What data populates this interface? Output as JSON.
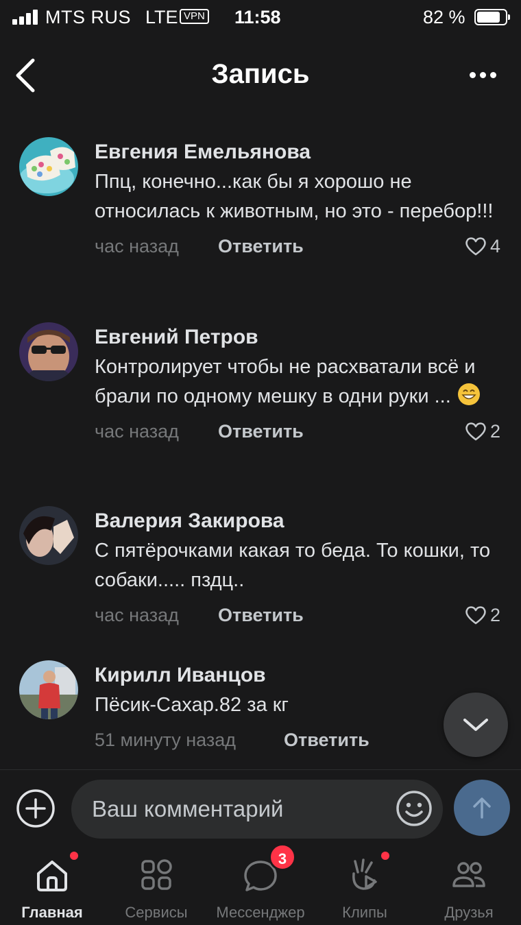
{
  "status_bar": {
    "carrier": "MTS RUS",
    "network": "LTE",
    "vpn": "VPN",
    "time": "11:58",
    "battery": "82 %"
  },
  "header": {
    "title": "Запись",
    "back_icon": "chevron-left-icon",
    "more_icon": "ellipsis-icon"
  },
  "comments": [
    {
      "author": "Евгения Емельянова",
      "text": "Ппц, конечно...как бы я хорошо не относилась к животным, но это - перебор!!!",
      "time": "час назад",
      "reply": "Ответить",
      "likes": "4"
    },
    {
      "author": "Евгений Петров",
      "text": "Контролирует чтобы не расхватали всё и брали по одному мешку в одни руки ...",
      "emoji": "grinning-face-icon",
      "time": "час назад",
      "reply": "Ответить",
      "likes": "2"
    },
    {
      "author": "Валерия Закирова",
      "text": "С пятёрочками какая то беда. То кошки, то собаки..... пздц..",
      "time": "час назад",
      "reply": "Ответить",
      "likes": "2"
    },
    {
      "author": "Кирилл Иванцов",
      "text": "Пёсик-Сахар.82 за кг",
      "time": "51 минуту назад",
      "reply": "Ответить"
    }
  ],
  "composer": {
    "placeholder": "Ваш комментарий"
  },
  "tabs": [
    {
      "label": "Главная",
      "icon": "home-icon",
      "active": true,
      "dot": true
    },
    {
      "label": "Сервисы",
      "icon": "services-icon"
    },
    {
      "label": "Мессенджер",
      "icon": "messenger-icon",
      "badge": "3"
    },
    {
      "label": "Клипы",
      "icon": "clips-icon",
      "dot": true
    },
    {
      "label": "Друзья",
      "icon": "friends-icon"
    }
  ],
  "colors": {
    "background": "#19191a",
    "text_primary": "#e1e3e6",
    "text_secondary": "#76787a",
    "accent_send": "#4a6a8e",
    "notification": "#ff3347"
  }
}
